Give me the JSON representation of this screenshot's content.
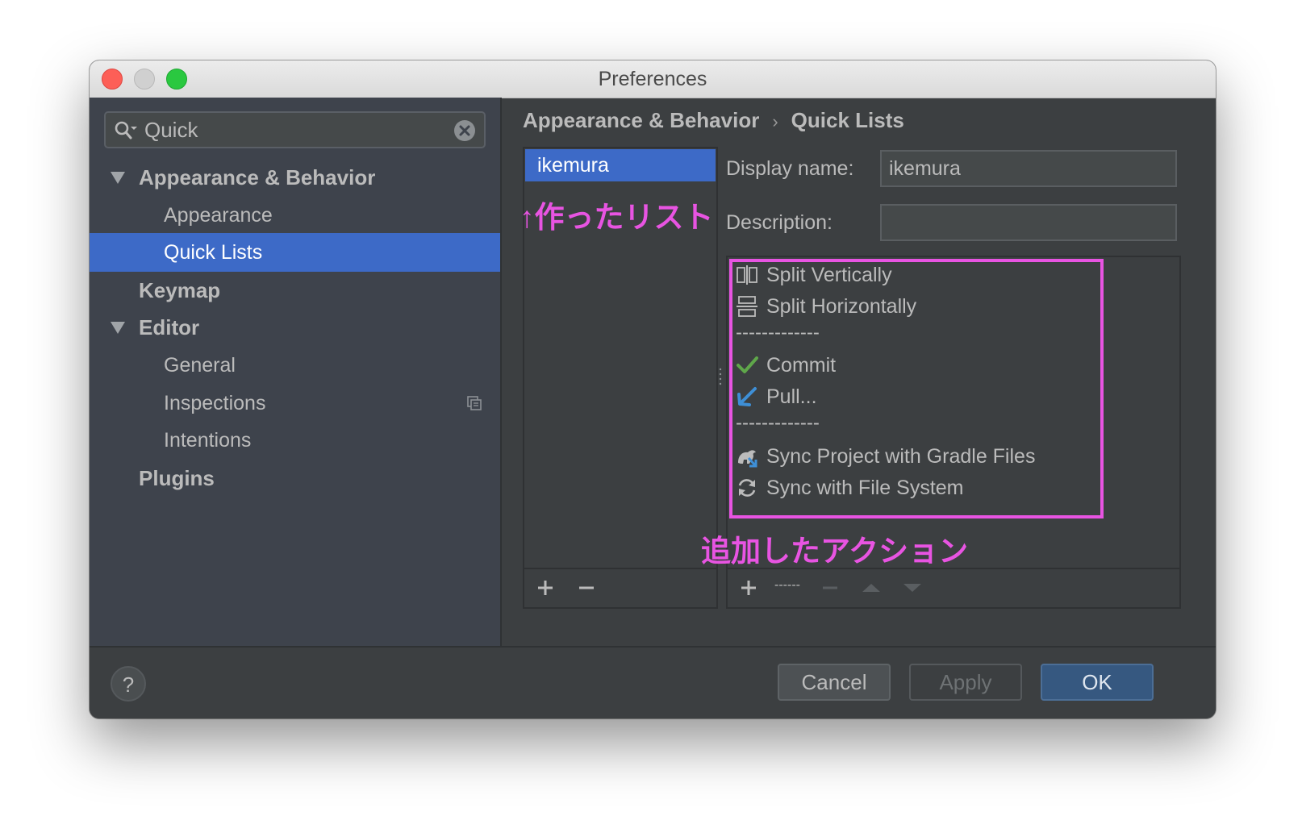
{
  "window": {
    "title": "Preferences"
  },
  "search": {
    "value": "Quick"
  },
  "sidebar": {
    "items": [
      {
        "label": "Appearance & Behavior"
      },
      {
        "label": "Appearance"
      },
      {
        "label": "Quick Lists"
      },
      {
        "label": "Keymap"
      },
      {
        "label": "Editor"
      },
      {
        "label": "General"
      },
      {
        "label": "Inspections"
      },
      {
        "label": "Intentions"
      },
      {
        "label": "Plugins"
      }
    ]
  },
  "breadcrumb": {
    "parent": "Appearance & Behavior",
    "separator": "›",
    "current": "Quick Lists"
  },
  "quick_lists": {
    "items": [
      "ikemura"
    ]
  },
  "annotations": {
    "list_note": "↑作ったリスト",
    "actions_note": "追加したアクション"
  },
  "form": {
    "display_name_label": "Display name:",
    "display_name_value": "ikemura",
    "description_label": "Description:",
    "description_value": ""
  },
  "actions": {
    "separator_text": "-------------",
    "items": [
      {
        "label": "Split Vertically",
        "icon": "split-vertically-icon"
      },
      {
        "label": "Split Horizontally",
        "icon": "split-horizontally-icon"
      },
      {
        "label": "Commit",
        "icon": "commit-check-icon"
      },
      {
        "label": "Pull...",
        "icon": "pull-arrow-icon"
      },
      {
        "label": "Sync Project with Gradle Files",
        "icon": "gradle-sync-icon"
      },
      {
        "label": "Sync with File System",
        "icon": "refresh-icon"
      }
    ],
    "toolbar_separator_label": "------"
  },
  "buttons": {
    "help": "?",
    "cancel": "Cancel",
    "apply": "Apply",
    "ok": "OK"
  },
  "colors": {
    "selection": "#3d6ac7",
    "annotation": "#e854e2",
    "commit_green": "#5fa74a",
    "pull_blue": "#3e8fd6",
    "ok_button": "#365880"
  }
}
